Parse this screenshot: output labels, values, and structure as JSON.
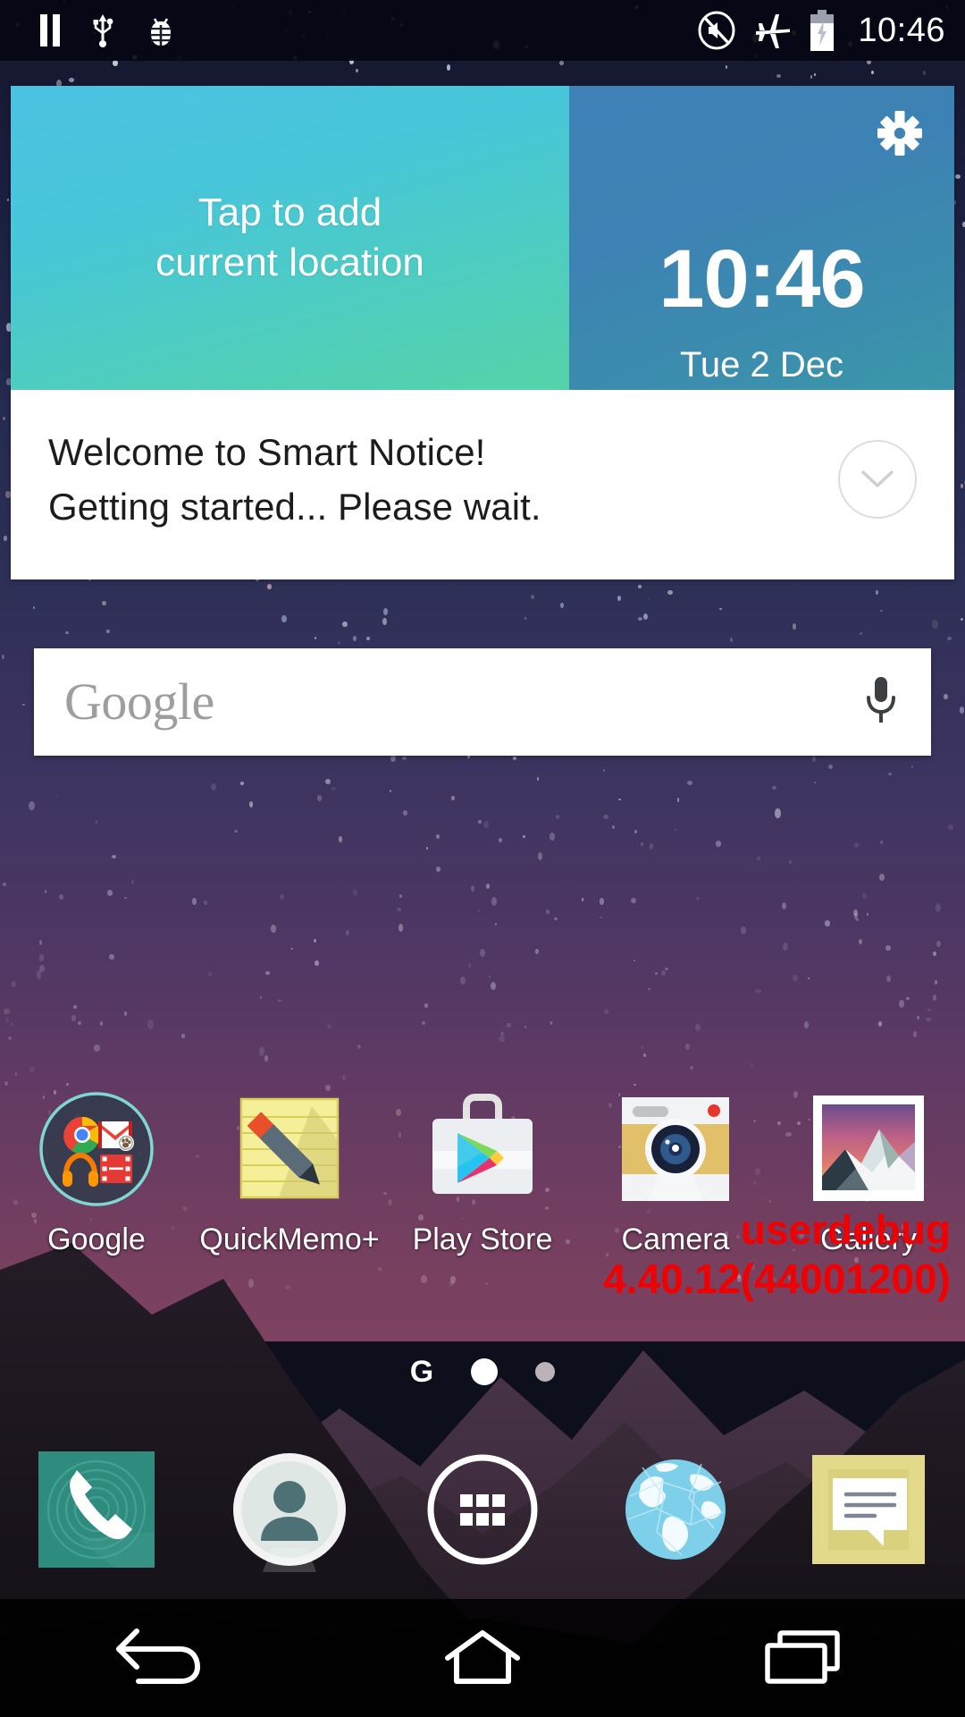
{
  "status_bar": {
    "left_icons": [
      {
        "name": "pause-icon",
        "label": "Pause"
      },
      {
        "name": "usb-icon",
        "label": "USB connected"
      },
      {
        "name": "bug-icon",
        "label": "Debug mode"
      }
    ],
    "right_icons": [
      {
        "name": "mute-icon",
        "label": "Sound off"
      },
      {
        "name": "airplane-mode-icon",
        "label": "Airplane mode"
      },
      {
        "name": "battery-charging-icon",
        "label": "Battery charging"
      }
    ],
    "clock": "10:46"
  },
  "smart_notice": {
    "weather_prompt": "Tap to add\ncurrent location",
    "weather_prompt_line1": "Tap to add",
    "weather_prompt_line2": "current location",
    "time": "10:46",
    "date": "Tue 2 Dec",
    "settings_icon": "gear-icon",
    "expand_icon": "chevron-down-icon",
    "card_line1": "Welcome to Smart Notice!",
    "card_line2": "Getting started... Please wait.",
    "colors": {
      "weather_gradient_start": "#4cc2e3",
      "weather_gradient_end": "#55d3a8",
      "clock_gradient_start": "#3f81b6",
      "clock_gradient_end": "#3a97a8",
      "card_background": "#ffffff"
    }
  },
  "search_widget": {
    "placeholder": "Google",
    "mic_icon": "microphone-icon"
  },
  "apps": [
    {
      "label": "Google",
      "icon": "google-folder-icon"
    },
    {
      "label": "QuickMemo+",
      "icon": "quickmemo-icon"
    },
    {
      "label": "Play Store",
      "icon": "play-store-icon"
    },
    {
      "label": "Camera",
      "icon": "camera-icon"
    },
    {
      "label": "Gallery",
      "icon": "gallery-icon"
    }
  ],
  "debug_overlay": {
    "build_type": "userdebug",
    "build_version": "4.40.12(44001200)",
    "color": "#f00000"
  },
  "page_indicator": {
    "google_now_glyph": "G",
    "pages": 2,
    "active_page": 1
  },
  "dock": [
    {
      "label": "Phone",
      "icon": "phone-icon"
    },
    {
      "label": "Contacts",
      "icon": "contacts-icon"
    },
    {
      "label": "Apps",
      "icon": "app-drawer-icon"
    },
    {
      "label": "Browser",
      "icon": "globe-browser-icon"
    },
    {
      "label": "Messaging",
      "icon": "messaging-icon"
    }
  ],
  "nav_bar": [
    {
      "label": "Back",
      "icon": "back-arrow-icon"
    },
    {
      "label": "Home",
      "icon": "home-icon"
    },
    {
      "label": "Recents",
      "icon": "recent-apps-icon"
    }
  ],
  "wallpaper": {
    "description": "Starry night sky over mountain silhouettes",
    "sky_top_color": "#14162b",
    "sky_horizon_color": "#7d4260",
    "mountain_color": "#241c26"
  }
}
